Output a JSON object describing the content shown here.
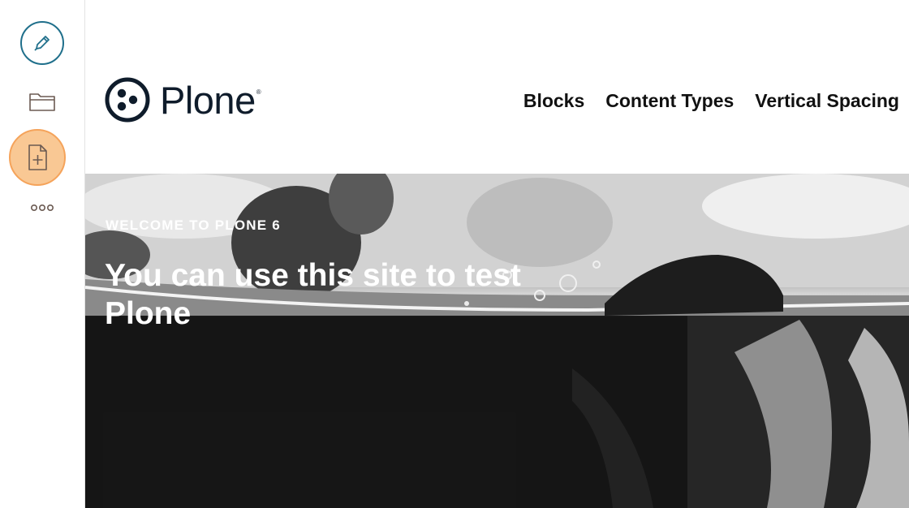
{
  "toolbar": {
    "items": [
      {
        "name": "edit",
        "icon": "pencil-icon"
      },
      {
        "name": "contents",
        "icon": "folder-icon"
      },
      {
        "name": "add",
        "icon": "add-document-icon"
      },
      {
        "name": "more",
        "icon": "more-dots-icon"
      }
    ],
    "colors": {
      "edit_ring": "#1f6f8b",
      "add_fill": "#f9c894",
      "add_ring": "#f5a35a"
    }
  },
  "header": {
    "logo_text": "Plone",
    "logo_registered": "®",
    "nav": [
      "Blocks",
      "Content Types",
      "Vertical Spacing"
    ]
  },
  "hero": {
    "kicker": "WELCOME TO PLONE 6",
    "title": "You can use this site to test Plone"
  }
}
